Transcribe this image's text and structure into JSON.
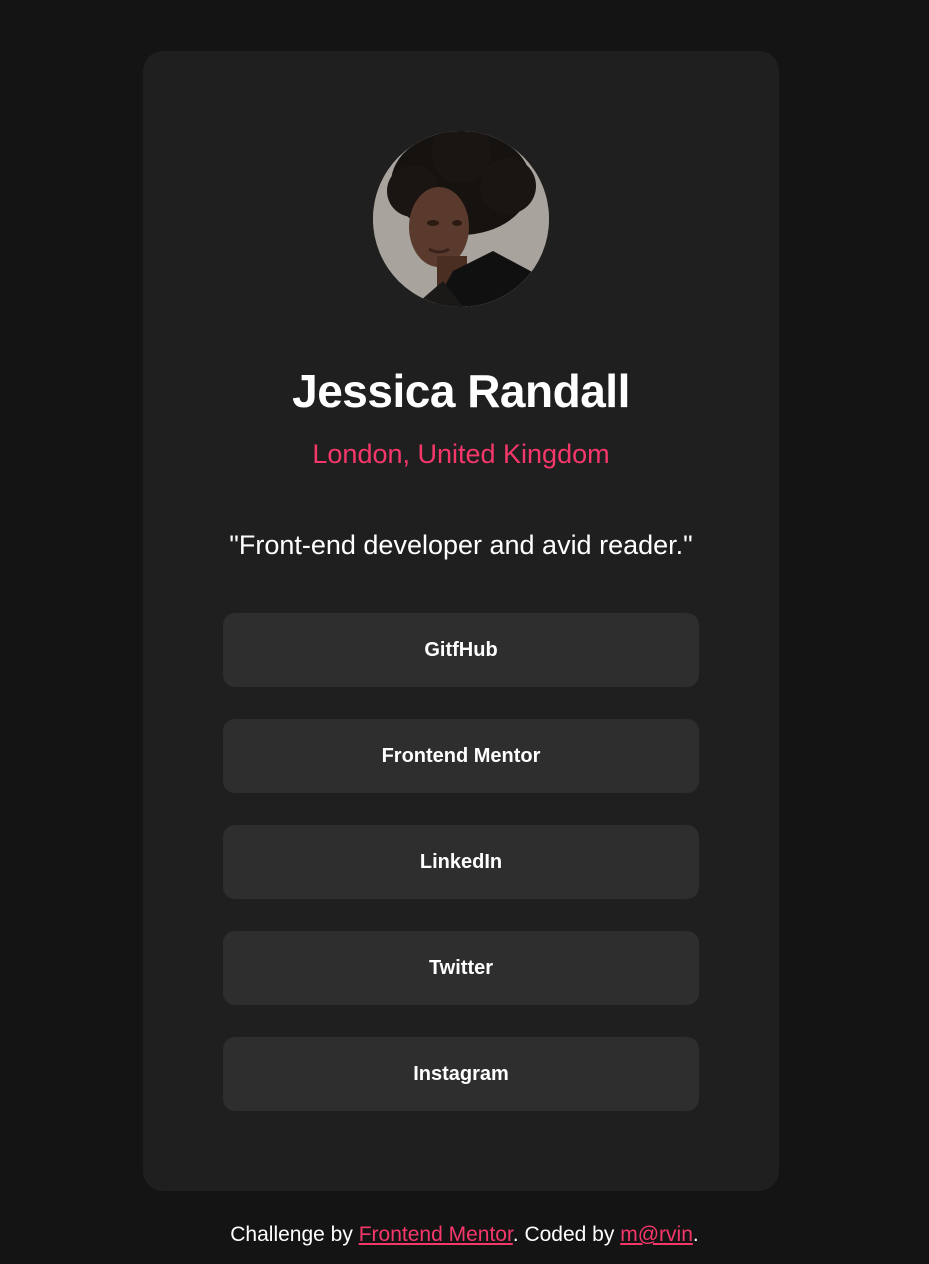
{
  "profile": {
    "name": "Jessica Randall",
    "location": "London, United Kingdom",
    "bio": "\"Front-end developer and avid reader.\""
  },
  "links": [
    {
      "label": "GitfHub"
    },
    {
      "label": "Frontend Mentor"
    },
    {
      "label": "LinkedIn"
    },
    {
      "label": "Twitter"
    },
    {
      "label": "Instagram"
    }
  ],
  "footer": {
    "prefix": "Challenge by",
    "challenge_link": "Frontend Mentor",
    "middle": ". Coded by",
    "author_link": "m@rvin",
    "suffix": "."
  },
  "colors": {
    "page_background": "#141414",
    "card_background": "#1f1f1f",
    "button_background": "#2e2e2e",
    "accent": "#f5376a",
    "text": "#ffffff"
  }
}
